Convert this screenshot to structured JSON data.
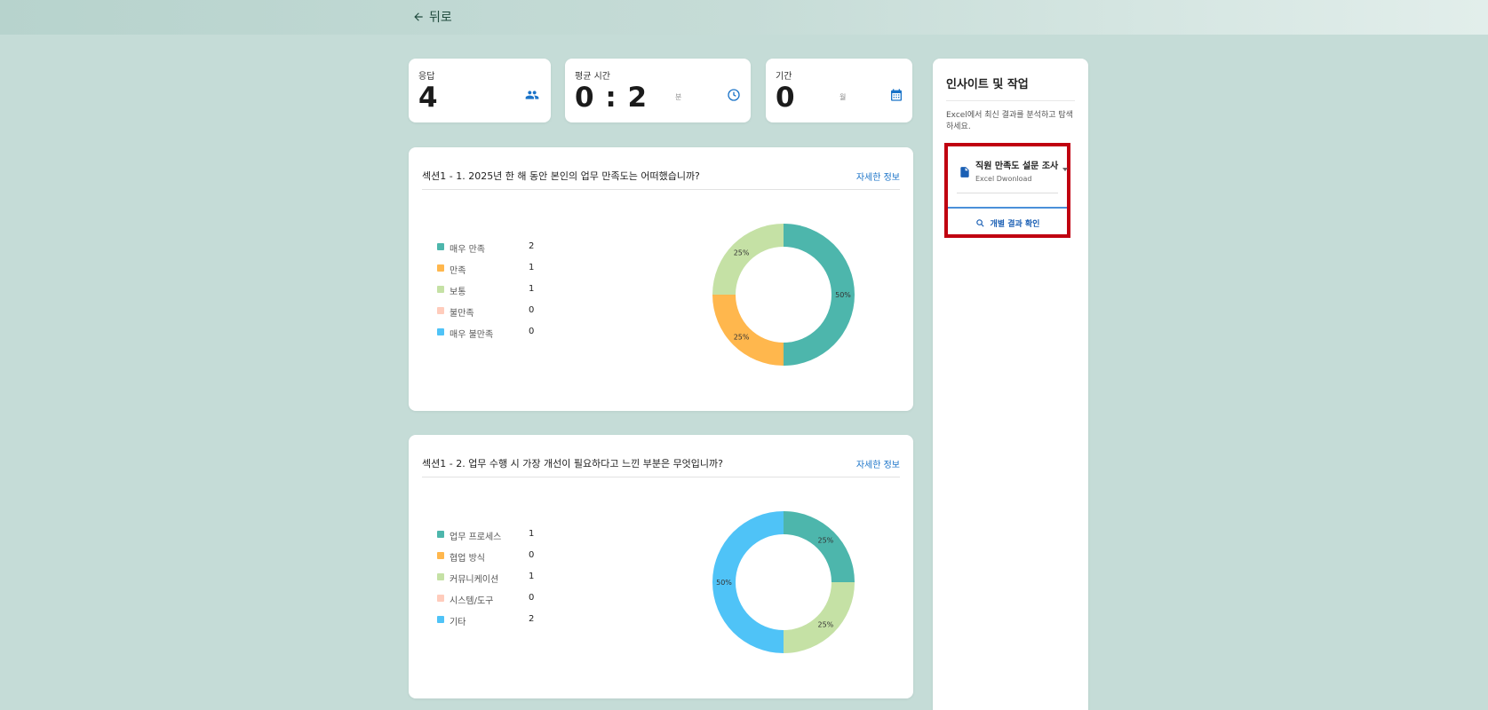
{
  "topbar": {
    "back_label": "뒤로"
  },
  "stats": [
    {
      "label": "응답",
      "value": "4",
      "unit": "",
      "icon": "people-icon"
    },
    {
      "label": "평균 시간",
      "value": "0 : 2",
      "unit": "분",
      "icon": "clock-icon"
    },
    {
      "label": "기간",
      "value": "0",
      "unit": "월",
      "icon": "calendar-icon"
    }
  ],
  "questions": [
    {
      "title": "섹션1 - 1. 2025년 한 해 동안 본인의 업무 만족도는 어떠했습니까?",
      "link": "자세한 정보",
      "legend": [
        {
          "label": "매우 만족",
          "count": "2"
        },
        {
          "label": "만족",
          "count": "1"
        },
        {
          "label": "보통",
          "count": "1"
        },
        {
          "label": "불만족",
          "count": "0"
        },
        {
          "label": "매우 불만족",
          "count": "0"
        }
      ]
    },
    {
      "title": "섹션1 - 2. 업무 수행 시 가장 개선이 필요하다고 느낀 부분은 무엇입니까?",
      "link": "자세한 정보",
      "legend": [
        {
          "label": "업무 프로세스",
          "count": "1"
        },
        {
          "label": "협업 방식",
          "count": "0"
        },
        {
          "label": "커뮤니케이션",
          "count": "1"
        },
        {
          "label": "시스템/도구",
          "count": "0"
        },
        {
          "label": "기타",
          "count": "2"
        }
      ]
    }
  ],
  "colors": [
    "#4db6ac",
    "#ffb74d",
    "#c5e1a5",
    "#ffccbc",
    "#4fc3f7"
  ],
  "chart_data": [
    {
      "type": "pie",
      "categories": [
        "매우 만족",
        "만족",
        "보통",
        "불만족",
        "매우 불만족"
      ],
      "values": [
        2,
        1,
        1,
        0,
        0
      ],
      "data_labels": [
        "50%",
        "25%",
        "25%",
        "",
        ""
      ]
    },
    {
      "type": "pie",
      "categories": [
        "업무 프로세스",
        "협업 방식",
        "커뮤니케이션",
        "시스템/도구",
        "기타"
      ],
      "values": [
        1,
        0,
        1,
        0,
        2
      ],
      "data_labels": [
        "25%",
        "",
        "25%",
        "",
        "50%"
      ]
    }
  ],
  "sidebar": {
    "title": "인사이트 및 작업",
    "description": "Excel에서 최신 결과를 분석하고 탐색하세요.",
    "file_name": "직원 만족도 설문 조사",
    "file_sub": "Excel Dwonload",
    "result_button": "개별 결과 확인"
  }
}
